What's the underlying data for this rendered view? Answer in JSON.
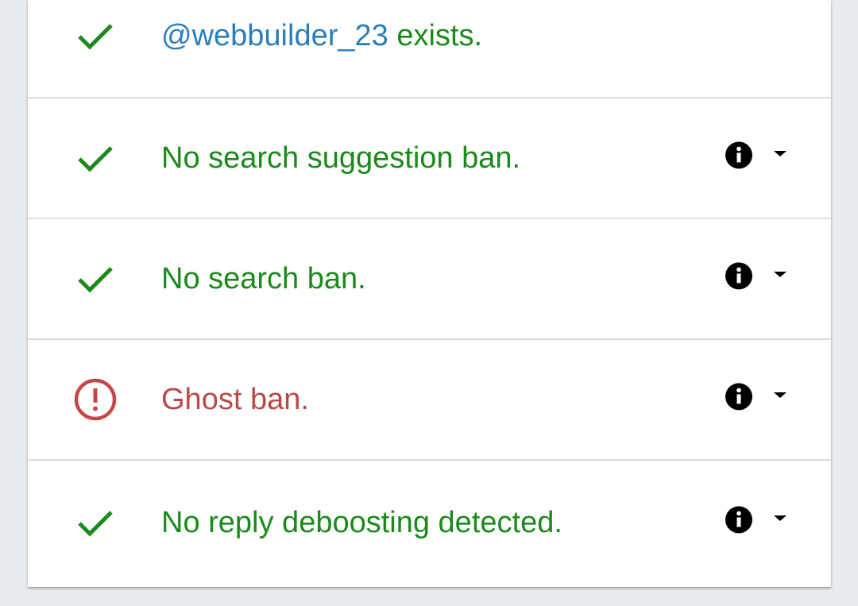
{
  "results": [
    {
      "status": "ok",
      "icon": "check-icon",
      "handle": "@webbuilder_23",
      "text": " exists.",
      "has_info": false
    },
    {
      "status": "ok",
      "icon": "check-icon",
      "text": "No search suggestion ban.",
      "has_info": true
    },
    {
      "status": "ok",
      "icon": "check-icon",
      "text": "No search ban.",
      "has_info": true
    },
    {
      "status": "bad",
      "icon": "alert-circle-icon",
      "text": "Ghost ban.",
      "has_info": true
    },
    {
      "status": "ok",
      "icon": "check-icon",
      "text": "No reply deboosting detected.",
      "has_info": true
    }
  ],
  "colors": {
    "ok": "#1a8a1a",
    "bad": "#b94848",
    "handle": "#2a7fba",
    "icon_dark": "#000000"
  }
}
